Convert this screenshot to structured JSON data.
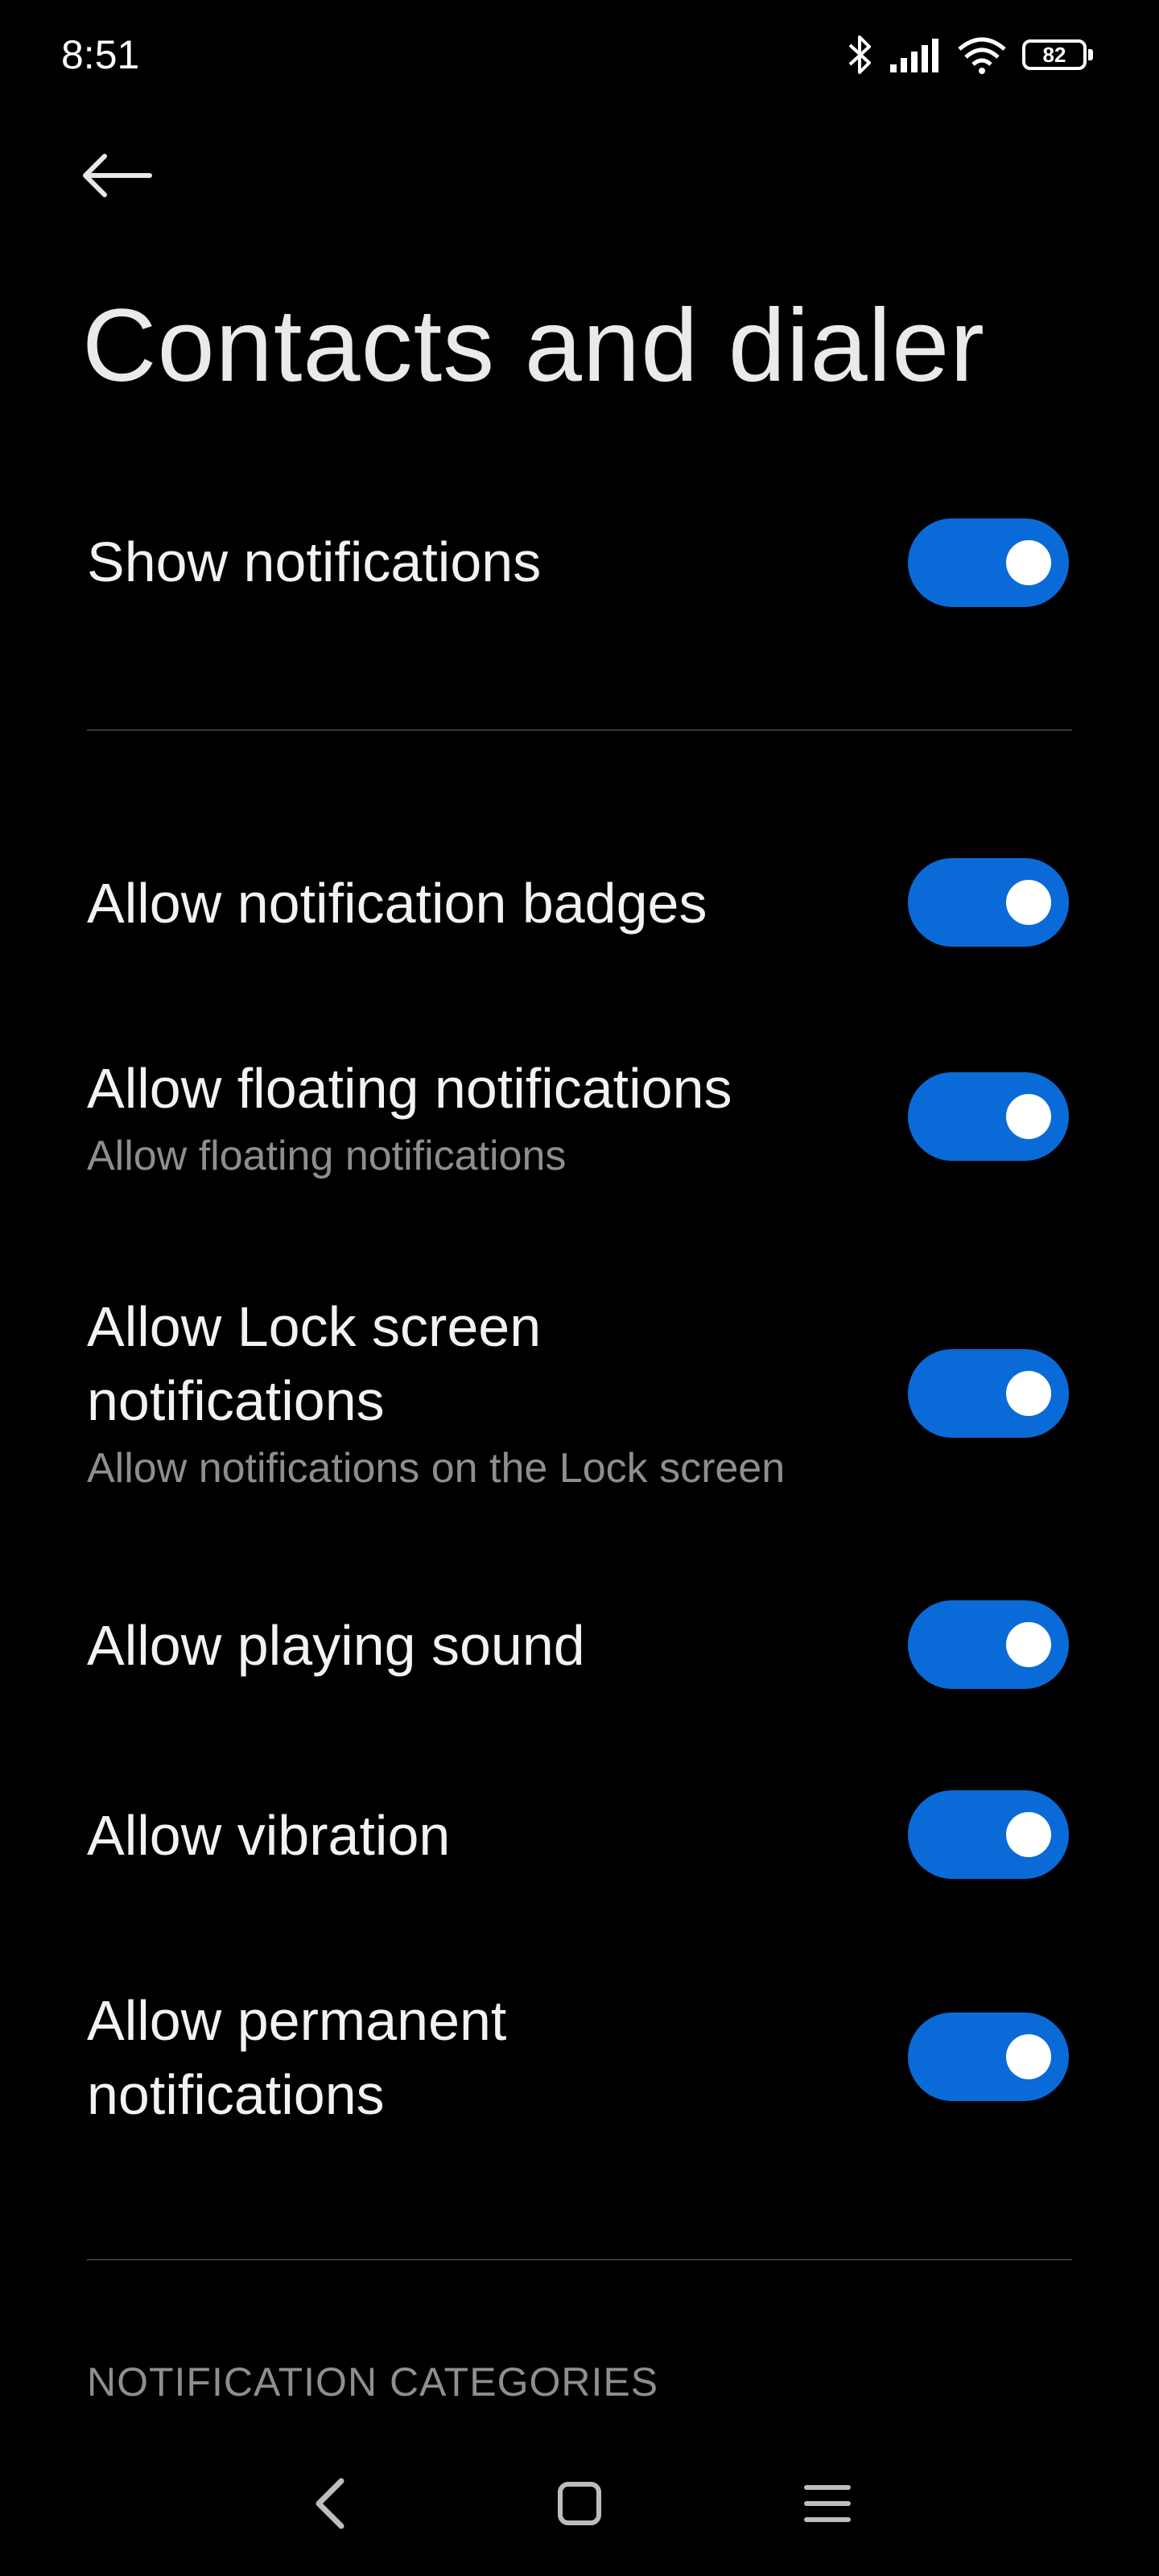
{
  "status_bar": {
    "time": "8:51",
    "battery": "82",
    "icons": [
      "bluetooth-icon",
      "signal-icon",
      "wifi-icon",
      "battery-icon"
    ]
  },
  "header": {
    "back_icon": "back-arrow-icon",
    "title": "Contacts and dialer"
  },
  "settings": {
    "show_notifications": {
      "label": "Show notifications",
      "enabled": true
    },
    "badges": {
      "label": "Allow notification badges",
      "enabled": true
    },
    "floating": {
      "label": "Allow floating notifications",
      "subtitle": "Allow floating notifications",
      "enabled": true
    },
    "lockscreen": {
      "label_line1": "Allow Lock screen",
      "label_line2": "notifications",
      "subtitle": "Allow notifications on the Lock screen",
      "enabled": true
    },
    "sound": {
      "label": "Allow playing sound",
      "enabled": true
    },
    "vibration": {
      "label": "Allow vibration",
      "enabled": true
    },
    "permanent": {
      "label_line1": "Allow permanent",
      "label_line2": "notifications",
      "enabled": true
    }
  },
  "section": {
    "categories_header": "NOTIFICATION CATEGORIES"
  },
  "nav_bar": {
    "icons": [
      "nav-back-icon",
      "nav-home-icon",
      "nav-recents-icon"
    ]
  },
  "colors": {
    "background": "#000000",
    "toggle_on": "#0a6bd8",
    "secondary_text": "#8e8e8e"
  }
}
